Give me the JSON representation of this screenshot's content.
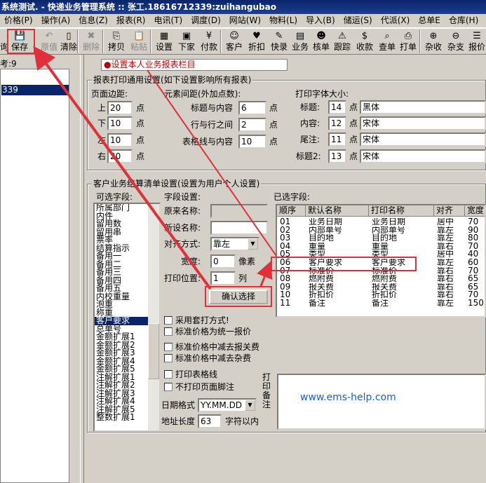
{
  "window": {
    "title": "系统测试. - 快递业务管理系统 :: 张工.18616712339:zuihangubao"
  },
  "menu": [
    {
      "label": "价格(P)"
    },
    {
      "label": "操作(A)"
    },
    {
      "label": "信息(Z)"
    },
    {
      "label": "报表(R)"
    },
    {
      "label": "电讯(T)"
    },
    {
      "label": "调度(D)"
    },
    {
      "label": "网站(W)"
    },
    {
      "label": "物料(L)"
    },
    {
      "label": "导入(B)"
    },
    {
      "label": "储运(S)"
    },
    {
      "label": "代派(X)"
    },
    {
      "label": "总单E"
    },
    {
      "label": "仓库(H)"
    }
  ],
  "toolbar": [
    {
      "label": "保存",
      "icon": "floppy-disk-icon",
      "enabled": true
    },
    {
      "label": "原值",
      "icon": "undo-icon",
      "enabled": false
    },
    {
      "label": "清除",
      "icon": "blank-page-icon",
      "enabled": true
    },
    {
      "label": "删除",
      "icon": "delete-x-icon",
      "enabled": false
    },
    {
      "label": "拷贝",
      "icon": "copy-icon",
      "enabled": true
    },
    {
      "label": "粘贴",
      "icon": "paste-icon",
      "enabled": false
    },
    {
      "label": "设置",
      "icon": "settings-grid-icon",
      "enabled": true
    },
    {
      "label": "下家",
      "icon": "next-station-icon",
      "enabled": true
    },
    {
      "label": "付款",
      "icon": "payment-icon",
      "enabled": true
    },
    {
      "label": "客户",
      "icon": "customer-icon",
      "enabled": true
    },
    {
      "label": "折扣",
      "icon": "discount-heart-icon",
      "enabled": true
    },
    {
      "label": "快录",
      "icon": "quick-entry-icon",
      "enabled": true
    },
    {
      "label": "业务",
      "icon": "business-icon",
      "enabled": true
    },
    {
      "label": "核单",
      "icon": "verify-order-icon",
      "enabled": true
    },
    {
      "label": "跟踪",
      "icon": "track-icon",
      "enabled": true
    },
    {
      "label": "收款",
      "icon": "collect-money-icon",
      "enabled": true
    },
    {
      "label": "查单",
      "icon": "search-order-icon",
      "enabled": true
    },
    {
      "label": "打单",
      "icon": "print-order-icon",
      "enabled": true
    },
    {
      "label": "杂收",
      "icon": "misc-income-icon",
      "enabled": true
    },
    {
      "label": "杂支",
      "icon": "misc-expense-icon",
      "enabled": true
    },
    {
      "label": "报价",
      "icon": "quote-icon",
      "enabled": true
    }
  ],
  "left": {
    "label": "考:9",
    "selected_item": "339",
    "toolbar_partial_label": "询"
  },
  "main": {
    "red_bar": "设置本人业务报表栏目",
    "print_group": {
      "title": "报表打印通用设置(如下设置影响所有报表)",
      "margin_title": "页面边距:",
      "top_label": "上",
      "top_value": "20",
      "bottom_label": "下",
      "bottom_value": "10",
      "left_label": "左",
      "left_value": "10",
      "right_label": "右",
      "right_value": "20",
      "unit": "点",
      "spacing_title": "元素间距(外加点数):",
      "title_content_label": "标题与内容",
      "title_content_value": "6",
      "row_row_label": "行与行之间",
      "row_row_value": "2",
      "table_content_label": "表格线与内容",
      "table_content_value": "10",
      "font_title": "打印字体大小:",
      "font_rows": [
        {
          "label": "标题:",
          "size": "14",
          "font": "黑体"
        },
        {
          "label": "内容:",
          "size": "12",
          "font": "宋体"
        },
        {
          "label": "尾注:",
          "size": "11",
          "font": "宋体"
        },
        {
          "label": "标题2:",
          "size": "13",
          "font": "宋体"
        }
      ]
    },
    "settle_group": {
      "title": "客户业务结算清单设置(设置为用户个人设置)",
      "available_title": "可选字段:",
      "available_fields": [
        "所属部门",
        "内件",
        "留用数",
        "留用串",
        "票率",
        "结算指示",
        "备用一",
        "备用二",
        "备用三",
        "备用四",
        "备用五",
        "内校重量",
        "泡重",
        "称重",
        "客户要求",
        "总单号",
        "金额扩展1",
        "金额扩展2",
        "金额扩展3",
        "金额扩展4",
        "金额扩展5",
        "注解扩展1",
        "注解扩展2",
        "注解扩展3",
        "注解扩展4",
        "注解扩展5",
        "整数扩展1"
      ],
      "selected_available": "客户要求",
      "field_settings_title": "字段设置:",
      "orig_name_label": "原来名称:",
      "orig_name_value": "",
      "new_name_label": "新设名称:",
      "new_name_value": "",
      "align_label": "对齐方式:",
      "align_value": "靠左",
      "width_label": "宽度:",
      "width_value": "0",
      "width_unit": "像素",
      "pos_label": "打印位置:",
      "pos_value": "1",
      "pos_unit": "列",
      "confirm_button": "确认选择",
      "checkboxes": [
        "采用套打方式!",
        "标准价格为统一报价",
        "标准价格中减去报关费",
        "标准价格中减去杂费",
        "打印表格线",
        "不打印页面脚注"
      ],
      "date_format_label": "日期格式",
      "date_format_value": "YY.MM.DD",
      "addr_len_label": "地址长度",
      "addr_len_value": "63",
      "addr_len_unit": "字符以内",
      "selected_title": "已选字段:",
      "columns": [
        "顺序",
        "默认名称",
        "打印名称",
        "对齐",
        "宽度"
      ],
      "rows": [
        [
          "01",
          "业务日期",
          "业务日期",
          "居中",
          "70"
        ],
        [
          "02",
          "内部单号",
          "内部单号",
          "靠左",
          "90"
        ],
        [
          "03",
          "目的地",
          "目的地",
          "靠左",
          "80"
        ],
        [
          "04",
          "重量",
          "重量",
          "靠右",
          "70"
        ],
        [
          "05",
          "类型",
          "类型",
          "居中",
          "40"
        ],
        [
          "06",
          "客户要求",
          "客户要求",
          "靠左",
          "60"
        ],
        [
          "07",
          "标准价",
          "标准价",
          "靠右",
          "70"
        ],
        [
          "08",
          "燃附费",
          "燃附费",
          "靠右",
          "65"
        ],
        [
          "09",
          "报关费",
          "报关费",
          "靠右",
          "65"
        ],
        [
          "10",
          "折扣价",
          "折扣价",
          "靠右",
          "70"
        ],
        [
          "11",
          "备注",
          "备注",
          "靠左",
          "150"
        ]
      ],
      "memo_label": "打印备注",
      "watermark": "www.ems-help.com"
    }
  },
  "colors": {
    "highlight": "#e0313a",
    "selection": "#0a246a",
    "watermark": "#1e5fd0"
  }
}
